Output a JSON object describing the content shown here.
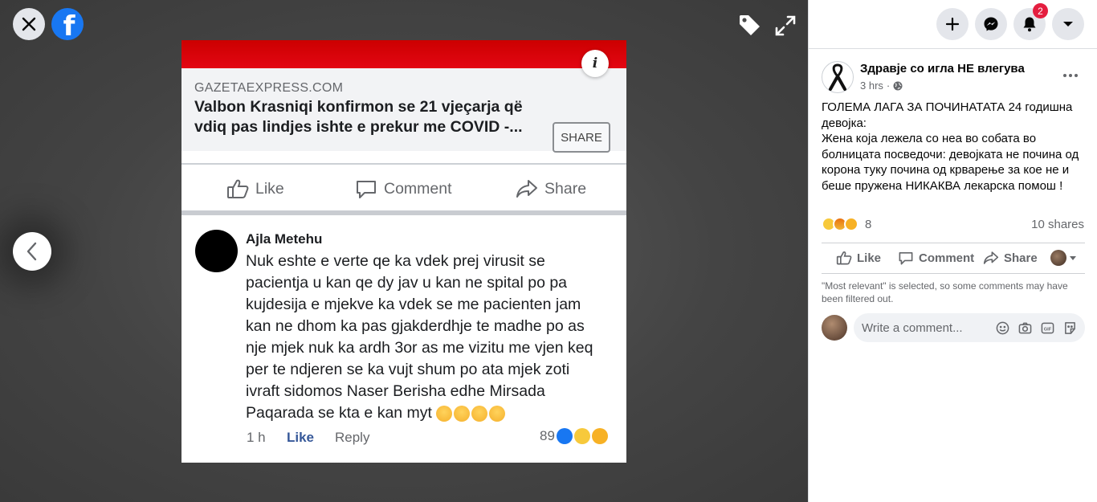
{
  "viewer": {
    "close_icon": "close-icon",
    "logo": "facebook-logo",
    "logo_letter": "f",
    "tag_icon": "tag-icon",
    "fullscreen_icon": "fullscreen-icon",
    "prev_icon": "chevron-left-icon"
  },
  "photo": {
    "link_domain": "GAZETAEXPRESS.COM",
    "link_title": "Valbon Krasniqi konfirmon se 21 vjeçarja që vdiq pas lindjes ishte e prekur me COVID -...",
    "link_share": "SHARE",
    "info_glyph": "i",
    "actions": {
      "like": "Like",
      "comment": "Comment",
      "share": "Share"
    },
    "comment": {
      "author": "Ajla Metehu",
      "text": "Nuk eshte e verte qe ka vdek prej virusit se pacientja u kan qe dy jav u kan ne spital po pa kujdesija e mjekve ka vdek se me pacienten jam kan ne dhom ka pas gjakderdhje te madhe po as nje mjek nuk ka ardh 3or as me vizitu me vjen keq per te ndjeren se ka vujt shum po ata mjek zoti ivraft sidomos Naser Berisha edhe Mirsada Paqarada se kta e kan myt",
      "time": "1 h",
      "like": "Like",
      "reply": "Reply",
      "reaction_count": "89"
    }
  },
  "panel": {
    "top_buttons": [
      "plus-icon",
      "messenger-icon",
      "notifications-icon",
      "caret-down-icon"
    ],
    "notification_count": "2",
    "post": {
      "author": "Здравје со игла НЕ влегува",
      "time": "3 hrs",
      "audience": "public",
      "text": "ГОЛЕМА ЛАГА ЗА ПОЧИНАТАТА 24 годишна девојка:\nЖена која лежела со неа во собата во болницата посведочи: девојката не почина од корона туку почина од крварење за кое не и беше пружена НИКАКВА лекарска помош !",
      "reaction_count": "8",
      "shares": "10 shares",
      "actions": {
        "like": "Like",
        "comment": "Comment",
        "share": "Share"
      },
      "filter_note": "\"Most relevant\" is selected, so some comments may have been filtered out.",
      "comment_placeholder": "Write a comment..."
    }
  },
  "colors": {
    "facebook_blue": "#1877f2",
    "badge_red": "#e41e3f",
    "news_red": "#e30613"
  }
}
